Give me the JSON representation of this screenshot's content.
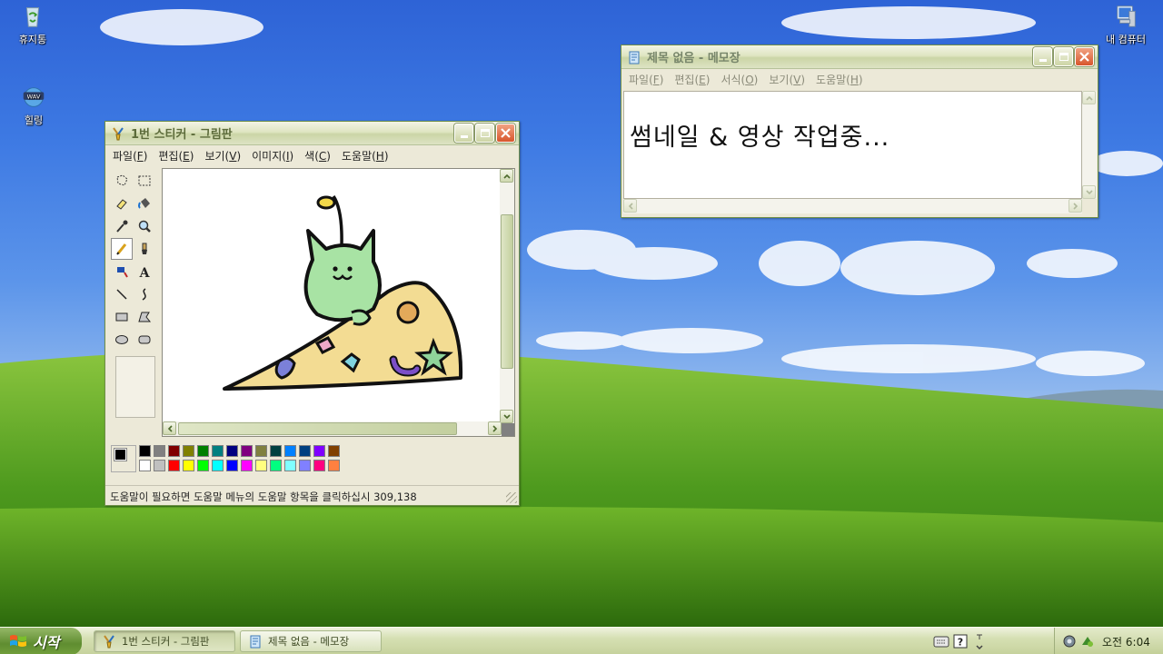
{
  "desktop": {
    "icons": [
      {
        "label": "휴지통"
      },
      {
        "label": "힐링"
      },
      {
        "label": "내 컴퓨터"
      }
    ]
  },
  "paint": {
    "title": "1번 스티커 - 그림판",
    "menu": [
      {
        "label": "파일",
        "key": "F"
      },
      {
        "label": "편집",
        "key": "E"
      },
      {
        "label": "보기",
        "key": "V"
      },
      {
        "label": "이미지",
        "key": "I"
      },
      {
        "label": "색",
        "key": "C"
      },
      {
        "label": "도움말",
        "key": "H"
      }
    ],
    "status": "도움말이 필요하면 도움말 메뉴의 도움말 항목을 클릭하십시 309,138",
    "palette_top": [
      "#000000",
      "#808080",
      "#800000",
      "#808000",
      "#008000",
      "#008080",
      "#000080",
      "#800080",
      "#808040",
      "#004040",
      "#0080ff",
      "#004080",
      "#8000ff",
      "#804000"
    ],
    "palette_bottom": [
      "#ffffff",
      "#c0c0c0",
      "#ff0000",
      "#ffff00",
      "#00ff00",
      "#00ffff",
      "#0000ff",
      "#ff00ff",
      "#ffff80",
      "#00ff80",
      "#80ffff",
      "#8080ff",
      "#ff0080",
      "#ff8040"
    ],
    "foreground": "#000000",
    "background": "#ffffff"
  },
  "notepad": {
    "title": "제목 없음 - 메모장",
    "menu": [
      {
        "label": "파일",
        "key": "F"
      },
      {
        "label": "편집",
        "key": "E"
      },
      {
        "label": "서식",
        "key": "O"
      },
      {
        "label": "보기",
        "key": "V"
      },
      {
        "label": "도움말",
        "key": "H"
      }
    ],
    "text": "썸네일 & 영상 작업중..."
  },
  "taskbar": {
    "start_label": "시작",
    "tasks": [
      {
        "label": "1번 스티커 - 그림판"
      },
      {
        "label": "제목 없음 - 메모장"
      }
    ],
    "clock": "오전 6:04"
  }
}
